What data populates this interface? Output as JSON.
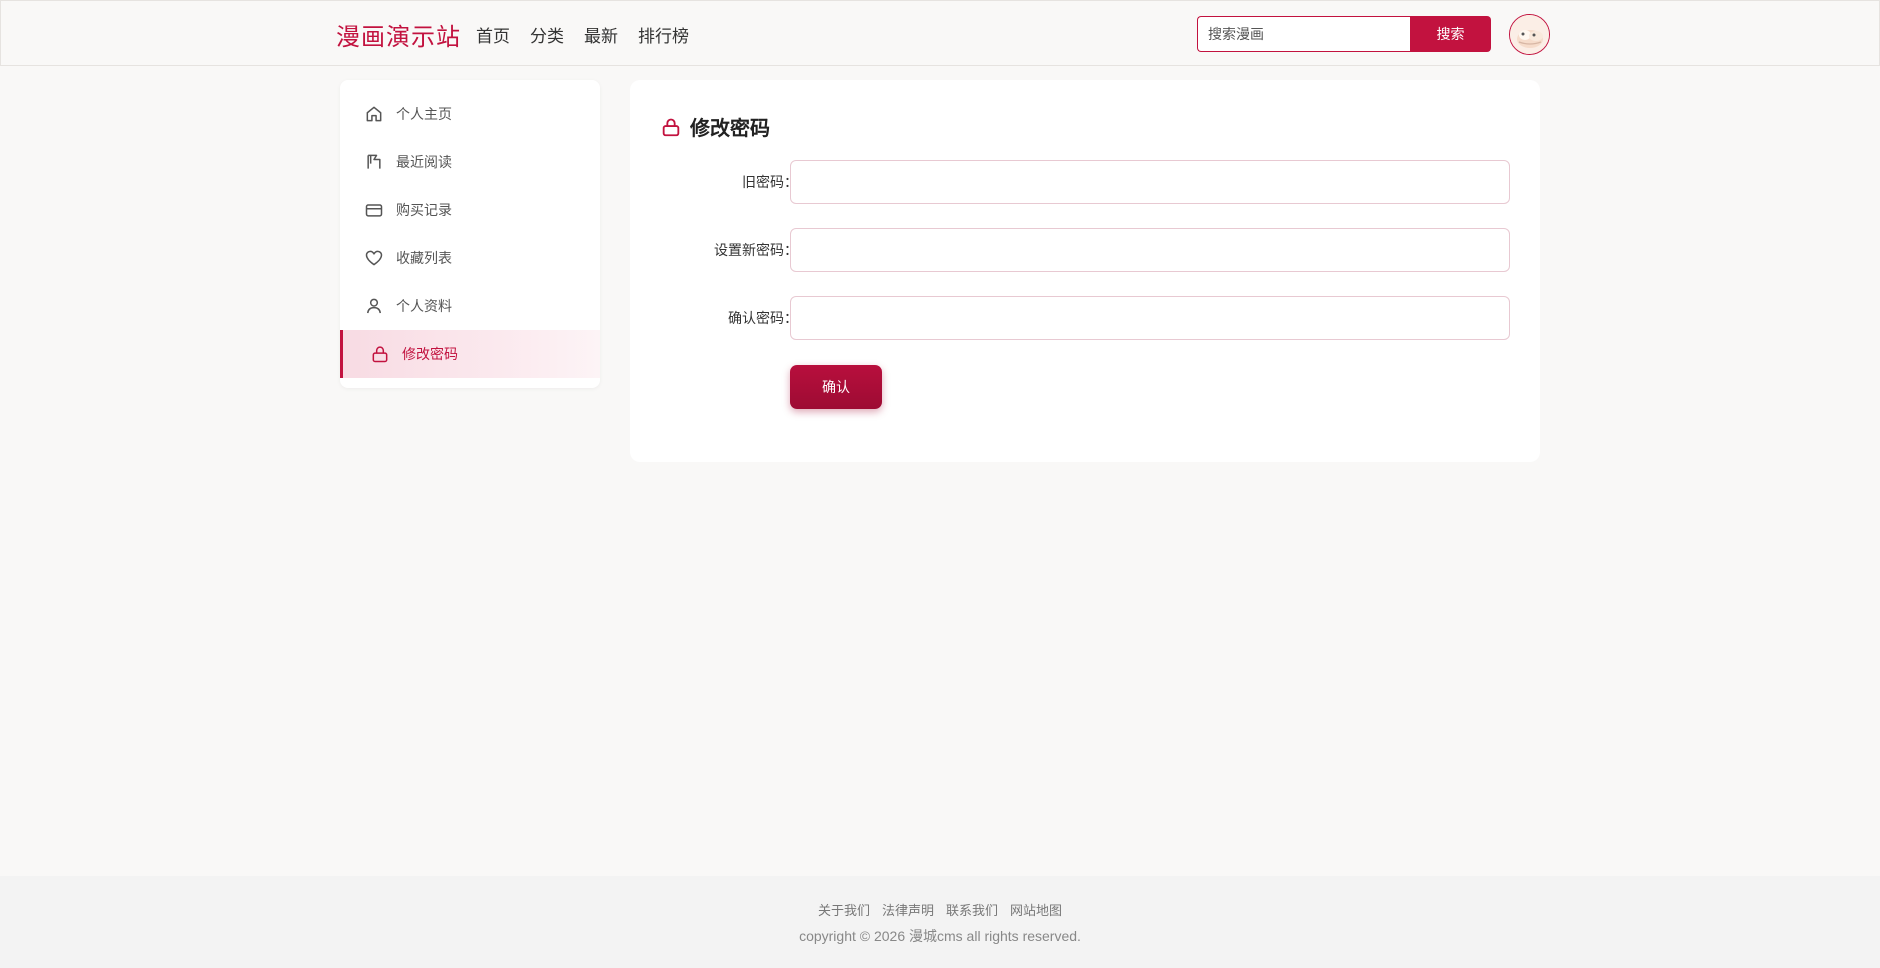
{
  "header": {
    "logo": "漫画演示站",
    "nav": [
      "首页",
      "分类",
      "最新",
      "排行榜"
    ],
    "search": {
      "placeholder": "搜索漫画",
      "button": "搜索"
    }
  },
  "sidebar": {
    "items": [
      {
        "label": "个人主页",
        "icon": "home-icon"
      },
      {
        "label": "最近阅读",
        "icon": "book-icon"
      },
      {
        "label": "购买记录",
        "icon": "credit-card-icon"
      },
      {
        "label": "收藏列表",
        "icon": "heart-icon"
      },
      {
        "label": "个人资料",
        "icon": "user-icon"
      },
      {
        "label": "修改密码",
        "icon": "lock-icon",
        "active": true
      }
    ]
  },
  "form": {
    "title": "修改密码",
    "fields": [
      {
        "label": "旧密码：",
        "value": ""
      },
      {
        "label": "设置新密码：",
        "value": ""
      },
      {
        "label": "确认密码：",
        "value": ""
      }
    ],
    "submit": "确认"
  },
  "footer": {
    "links": [
      "关于我们",
      "法律声明",
      "联系我们",
      "网站地图"
    ],
    "copyright": "copyright © 2026 漫城cms all rights reserved."
  },
  "colors": {
    "accent": "#c2123f",
    "background": "#f9f8f7"
  }
}
